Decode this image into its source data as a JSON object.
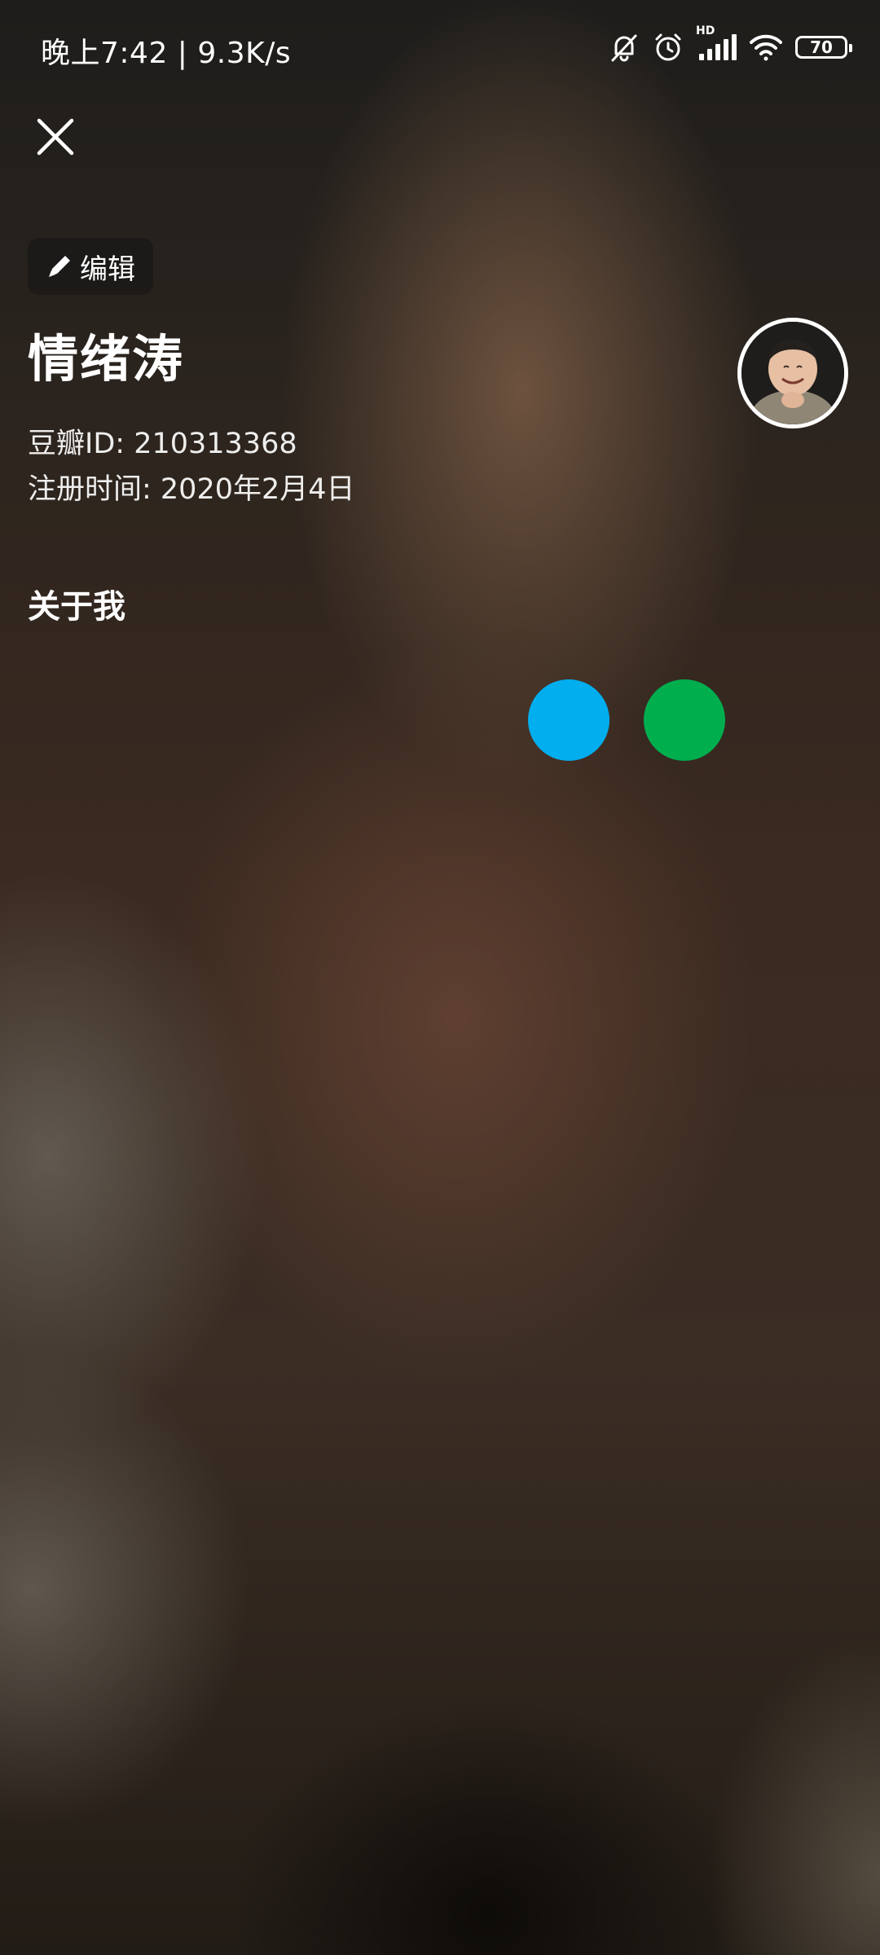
{
  "status_bar": {
    "time_speed": "晚上7:42 | 9.3K/s",
    "network_label": "HD",
    "battery_level": "70"
  },
  "profile": {
    "edit_label": "编辑",
    "name": "情绪涛",
    "douban_id": "豆瓣ID: 210313368",
    "register_time": "注册时间: 2020年2月4日",
    "about_title": "关于我"
  },
  "icons": {
    "close": "close-icon",
    "edit": "pencil-icon",
    "mute": "bell-off-icon",
    "alarm": "alarm-icon",
    "signal": "signal-icon",
    "wifi": "wifi-icon"
  },
  "colors": {
    "loading_dot_blue": "#03AEEF",
    "loading_dot_green": "#00AE4E"
  }
}
